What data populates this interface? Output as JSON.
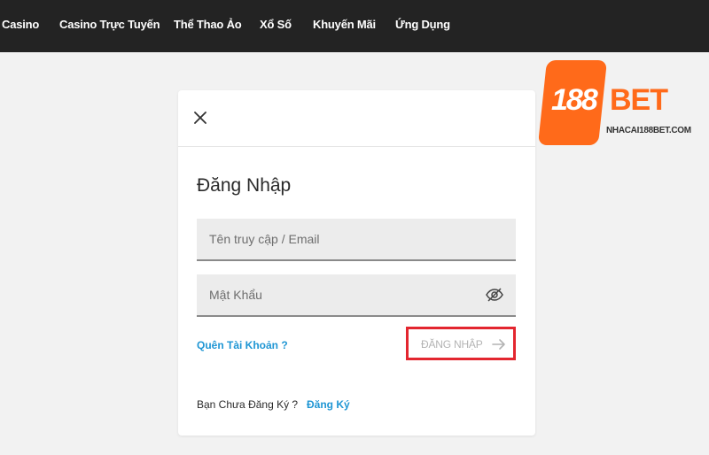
{
  "nav": {
    "items": [
      "Casino",
      "Casino Trực Tuyến",
      "Thể Thao Ảo",
      "Xổ Số",
      "Khuyến Mãi",
      "Ứng Dụng"
    ]
  },
  "login": {
    "title": "Đăng Nhập",
    "username": {
      "value": "",
      "placeholder": "Tên truy cập / Email"
    },
    "password": {
      "value": "",
      "placeholder": "Mật Khẩu"
    },
    "forgot_label": "Quên Tài Khoản ?",
    "submit_label": "ĐĂNG NHẬP",
    "register_question": "Bạn Chưa Đăng Ký ?",
    "register_label": "Đăng Ký"
  },
  "logo": {
    "number": "188",
    "word": "BET",
    "url": "NHACAI188BET.COM"
  },
  "colors": {
    "nav_background": "#232323",
    "link": "#1f96d4",
    "highlight_border": "#e3262f",
    "brand_orange": "#ff6a1a"
  },
  "icons": {
    "close": "close-icon",
    "password_toggle": "eye-icon",
    "submit": "arrow-right-icon"
  }
}
